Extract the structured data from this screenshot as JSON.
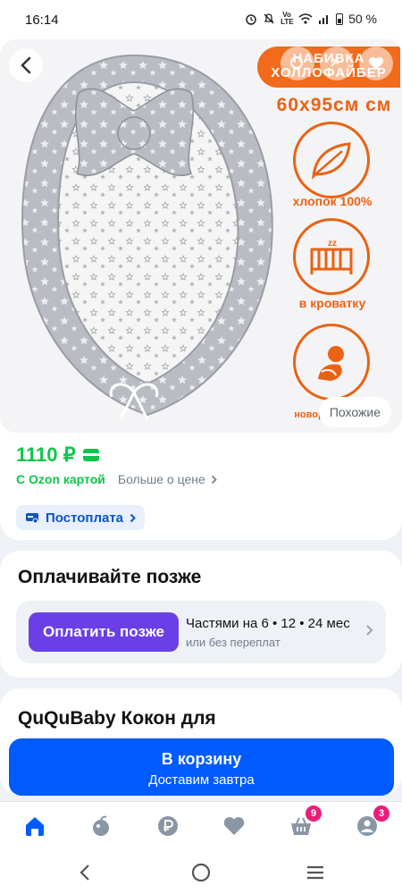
{
  "status_bar": {
    "time": "16:14",
    "battery": "50 %"
  },
  "gallery": {
    "fill_badge_line1": "НАБИВКА",
    "fill_badge_line2": "ХОЛЛОФАЙБЕР",
    "size": "60x95см см",
    "feature1": "хлопок 100%",
    "feature2": "в кроватку",
    "feature3": "новор",
    "similar_button": "Похожие"
  },
  "price": {
    "value": "1110 ₽",
    "ozon_card_label": "С Ozon картой",
    "more_about_price": "Больше о цене",
    "postpay_label": "Постоплата"
  },
  "pay_later": {
    "title": "Оплачивайте позже",
    "button": "Оплатить позже",
    "installments": "Частями на 6 • 12 • 24 мес",
    "no_overpay": "или без переплат"
  },
  "product": {
    "title": "QuQuBaby Кокон для"
  },
  "cart": {
    "button": "В корзину",
    "delivery": "Доставим завтра"
  },
  "tabbar": {
    "items": [
      "home-icon",
      "fresh-icon",
      "ruble-icon",
      "heart-icon",
      "basket-icon",
      "profile-icon"
    ],
    "basket_badge": "9",
    "profile_badge": "3"
  },
  "colors": {
    "brand_blue": "#005bff",
    "price_green": "#10c44c",
    "pay_later_purple": "#6a3fe6",
    "badge_pink": "#e91e78",
    "accent_orange": "#ea6214"
  }
}
